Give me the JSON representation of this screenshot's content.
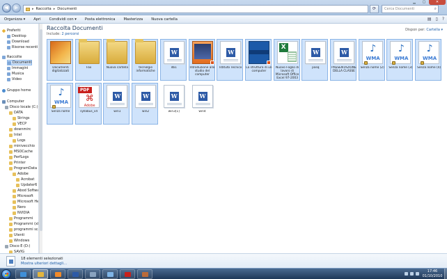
{
  "window": {
    "breadcrumb": [
      "Raccolta",
      "Documenti"
    ],
    "search_placeholder": "Cerca Documenti"
  },
  "toolbar": {
    "items": [
      "Organizza ▾",
      "Apri",
      "Condividi con ▾",
      "Posta elettronica",
      "Masterizza",
      "Nuova cartella"
    ]
  },
  "sidebar": {
    "items": [
      {
        "label": "Preferiti",
        "icon": "star-icon"
      },
      {
        "label": "Desktop",
        "icon": "desktop-icon"
      },
      {
        "label": "Download",
        "icon": "download-icon"
      },
      {
        "label": "Risorse recenti",
        "icon": "recent-places-icon"
      },
      {
        "label": "Raccolte",
        "icon": "library-icon"
      },
      {
        "label": "Documenti",
        "icon": "documents-icon"
      },
      {
        "label": "Immagini",
        "icon": "pictures-icon"
      },
      {
        "label": "Musica",
        "icon": "music-icon"
      },
      {
        "label": "Video",
        "icon": "video-icon"
      },
      {
        "label": "Gruppo home",
        "icon": "homegroup-icon"
      },
      {
        "label": "Computer",
        "icon": "computer-icon"
      },
      {
        "label": "Disco locale (C:)",
        "icon": "disk-icon"
      },
      {
        "label": "DATA",
        "icon": "folder-icon"
      },
      {
        "label": "Strings",
        "icon": "folder-icon"
      },
      {
        "label": "VECP",
        "icon": "folder-icon"
      },
      {
        "label": "downmirc",
        "icon": "folder-icon"
      },
      {
        "label": "Intel",
        "icon": "folder-icon"
      },
      {
        "label": "Logs",
        "icon": "folder-icon"
      },
      {
        "label": "minivecchio",
        "icon": "folder-icon"
      },
      {
        "label": "MSOCache",
        "icon": "folder-icon"
      },
      {
        "label": "PerfLogs",
        "icon": "folder-icon"
      },
      {
        "label": "Printer",
        "icon": "folder-icon"
      },
      {
        "label": "ProgramData",
        "icon": "folder-icon"
      },
      {
        "label": "Adobe",
        "icon": "folder-icon"
      },
      {
        "label": "Acrobat",
        "icon": "folder-icon"
      },
      {
        "label": "Updater6",
        "icon": "folder-icon"
      },
      {
        "label": "Abod Softwar",
        "icon": "folder-icon"
      },
      {
        "label": "Microsoft",
        "icon": "folder-icon"
      },
      {
        "label": "Microsoft He",
        "icon": "folder-icon"
      },
      {
        "label": "Nero",
        "icon": "folder-icon"
      },
      {
        "label": "NVIDIA",
        "icon": "folder-icon"
      },
      {
        "label": "Programmi",
        "icon": "folder-icon"
      },
      {
        "label": "Programmi (x8",
        "icon": "folder-icon"
      },
      {
        "label": "programmi sca",
        "icon": "folder-icon"
      },
      {
        "label": "Utenti",
        "icon": "folder-icon"
      },
      {
        "label": "Windows",
        "icon": "folder-icon"
      },
      {
        "label": "Disco E (D:)",
        "icon": "disk-icon"
      },
      {
        "label": "SAVIG",
        "icon": "folder-icon"
      }
    ]
  },
  "main": {
    "title": "Raccolta Documenti",
    "includes_label": "Include:",
    "includes_link": "2 percorsi",
    "arrange_label": "Dispon per:",
    "arrange_value": "Cartella ▾",
    "files": [
      {
        "name": "Documenti digitalizzati",
        "kind": "photo-folder",
        "selected": true
      },
      {
        "name": "Fax",
        "kind": "folder",
        "selected": true
      },
      {
        "name": "Nuova cartella",
        "kind": "folder",
        "selected": true
      },
      {
        "name": "tecnolgie informatiche",
        "kind": "folder",
        "selected": true
      },
      {
        "name": "db1",
        "kind": "word",
        "selected": true
      },
      {
        "name": "Introduzione allo studio del computer",
        "kind": "ppt",
        "selected": true
      },
      {
        "name": "Istituto Tecnico",
        "kind": "word",
        "selected": true
      },
      {
        "name": "La struttura di un computer",
        "kind": "blue",
        "selected": true
      },
      {
        "name": "Nuovo Foglio di lavoro di Microsoft Office Excel 97-2003",
        "kind": "excel",
        "selected": true
      },
      {
        "name": "pasq",
        "kind": "word",
        "selected": true
      },
      {
        "name": "PRESENTAZIONE DELLA CLASSE",
        "kind": "word",
        "selected": true
      },
      {
        "name": "Senza nome (2)",
        "kind": "wma",
        "selected": true
      },
      {
        "name": "Senza nome (3)",
        "kind": "wma",
        "selected": true
      },
      {
        "name": "Senza nome (4)",
        "kind": "wma",
        "selected": true
      },
      {
        "name": "Senza nome",
        "kind": "wma",
        "selected": true
      },
      {
        "name": "syllabus_v4",
        "kind": "pdf",
        "selected": true
      },
      {
        "name": "win1",
        "kind": "word",
        "selected": true
      },
      {
        "name": "win2",
        "kind": "word",
        "selected": true
      },
      {
        "name": "win3[1]",
        "kind": "word",
        "selected": false
      },
      {
        "name": "win4",
        "kind": "word",
        "selected": false
      }
    ]
  },
  "details": {
    "count": "18 elementi selezionati",
    "more": "Mostra ulteriori dettagli..."
  },
  "taskbar": {
    "time": "17:46",
    "date": "01/10/2010",
    "buttons": [
      "internet-explorer-icon",
      "explorer-icon",
      "media-player-icon",
      "word-icon",
      "disc-icon",
      "search-icon",
      "adobe-reader-icon",
      "photo-icon"
    ]
  }
}
